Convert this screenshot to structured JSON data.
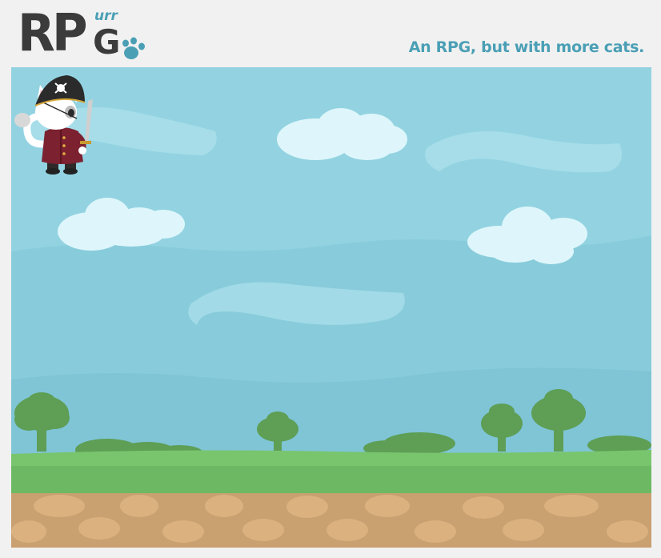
{
  "header": {
    "logo_main": "RP",
    "logo_g": "G",
    "logo_superscript": "urr",
    "tagline": "An RPG, but with more cats."
  },
  "icons": {
    "logo_paw": "paw-icon",
    "player": "pirate-cat-sprite",
    "cloud": "cloud-icon",
    "tree": "tree-icon"
  },
  "colors": {
    "background": "#f1f1f1",
    "logo_dark": "#3b3b3b",
    "accent": "#4a9fb5",
    "sky": "#8fd3e0",
    "grass": "#6dbb63",
    "dirt": "#c9a070"
  }
}
